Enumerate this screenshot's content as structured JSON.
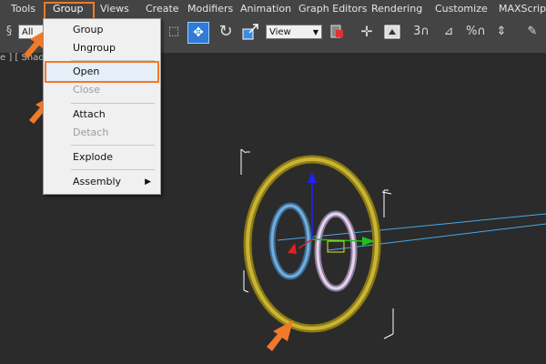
{
  "menubar": {
    "items": [
      "Tools",
      "Group",
      "Views",
      "Create",
      "Modifiers",
      "Animation",
      "Graph Editors",
      "Rendering",
      "Customize",
      "MAXScript"
    ]
  },
  "toolbar": {
    "selection_filter": "All",
    "reference_coord": "View",
    "snap_label": "3",
    "percent_label": "%"
  },
  "viewport": {
    "label": "e ] [ Shaded ]"
  },
  "group_menu": {
    "items": [
      "Group",
      "Ungroup",
      "Open",
      "Close",
      "Attach",
      "Detach",
      "Explode",
      "Assembly"
    ],
    "disabled": [
      "Close",
      "Detach"
    ]
  },
  "colors": {
    "highlight": "#f07a2a",
    "menubar": "#444444",
    "viewport": "#2b2b2b"
  }
}
